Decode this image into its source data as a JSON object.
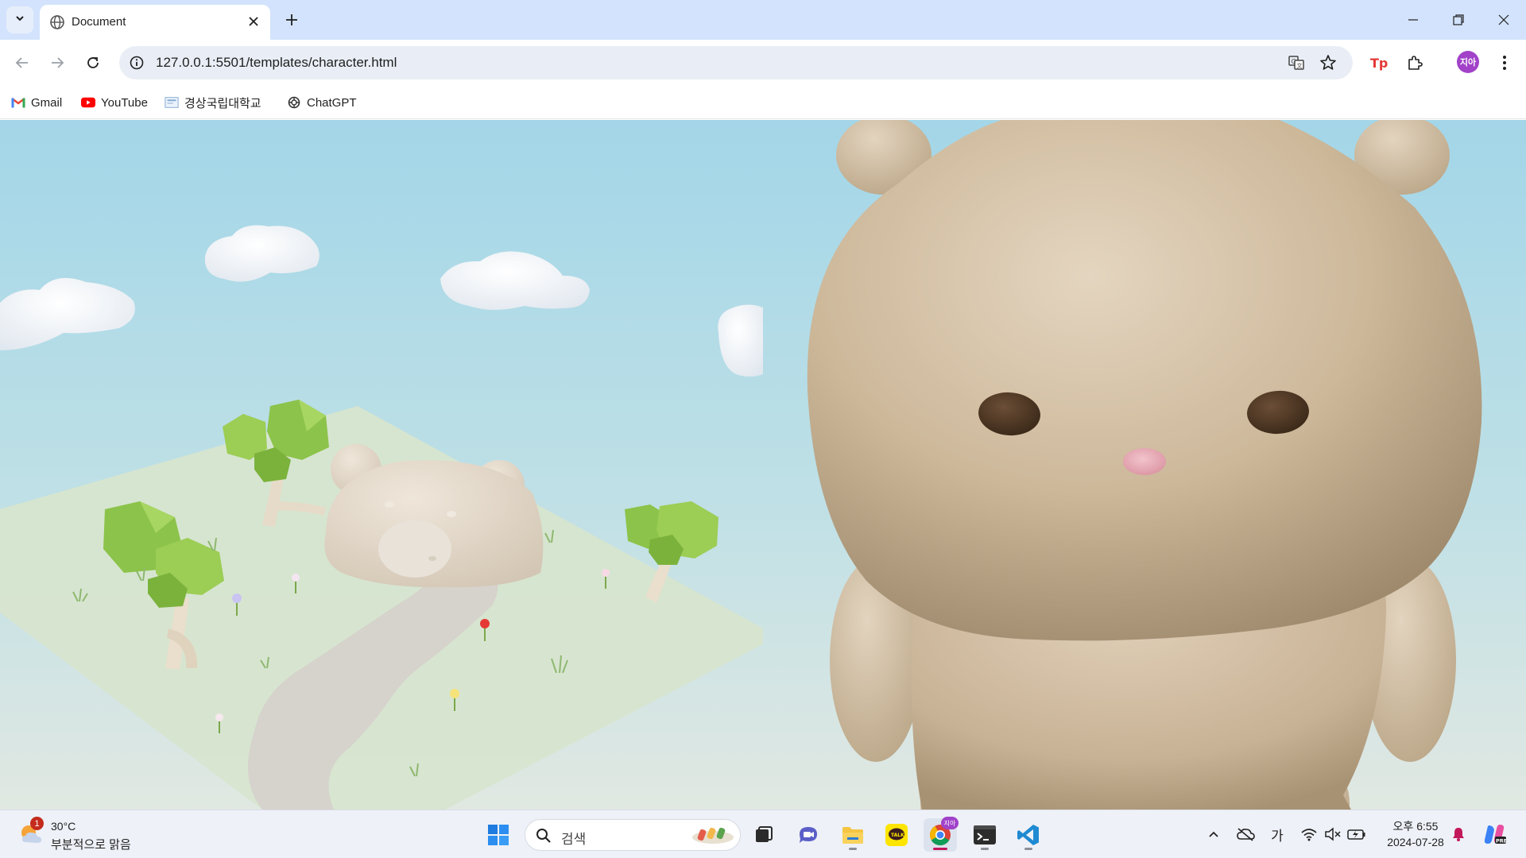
{
  "browser": {
    "tab_title": "Document",
    "url": "127.0.0.1:5501/templates/character.html",
    "profile_initials": "지아"
  },
  "bookmarks": [
    {
      "label": "Gmail",
      "icon": "gmail-icon"
    },
    {
      "label": "YouTube",
      "icon": "youtube-icon"
    },
    {
      "label": "경상국립대학교",
      "icon": "university-icon"
    },
    {
      "label": "ChatGPT",
      "icon": "chatgpt-icon"
    }
  ],
  "scene": {
    "sky_top": "#a3d6e8",
    "sky_bottom": "#e1e8e2",
    "ground_color": "#d7e5cf",
    "path_color": "#d6d2cc",
    "tree_leaf_color": "#8cc34a",
    "bear_fur_color": "#d8c6ae",
    "bear_eye_color": "#4a3524",
    "bear_nose_color": "#e8a8b4"
  },
  "taskbar": {
    "weather_temp": "30°C",
    "weather_desc": "부분적으로 맑음",
    "weather_badge": "1",
    "search_placeholder": "검색",
    "ime_label": "가",
    "time": "오후 6:55",
    "date": "2024-07-28",
    "chrome_badge": "지아"
  }
}
